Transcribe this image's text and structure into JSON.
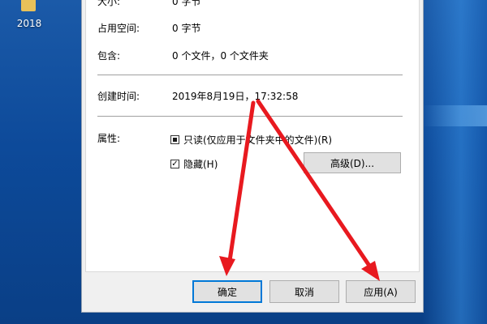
{
  "desktop": {
    "icon": "folder-icon",
    "label": "2018"
  },
  "dialog": {
    "size_label": "大小:",
    "size_value": "0 字节",
    "disk_label": "占用空间:",
    "disk_value": "0 字节",
    "contains_label": "包含:",
    "contains_value": "0 个文件，0 个文件夹",
    "created_label": "创建时间:",
    "created_value": "2019年8月19日，17:32:58",
    "attributes_label": "属性:",
    "readonly_label": "只读(仅应用于文件夹中的文件)(R)",
    "readonly_state": "indeterminate",
    "hidden_label": "隐藏(H)",
    "hidden_state": "checked",
    "advanced_button": "高级(D)...",
    "ok_button": "确定",
    "cancel_button": "取消",
    "apply_button": "应用(A)"
  },
  "colors": {
    "arrow": "#e8191f",
    "default_button_border": "#0078d7"
  }
}
